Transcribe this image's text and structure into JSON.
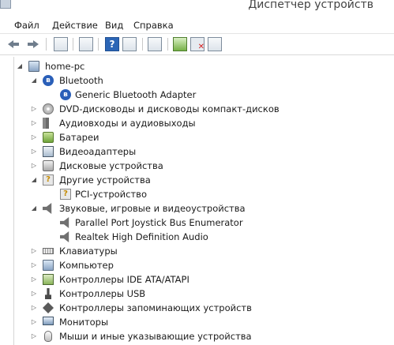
{
  "window": {
    "title": "Диспетчер устройств"
  },
  "menubar": {
    "items": [
      "Файл",
      "Действие",
      "Вид",
      "Справка"
    ]
  },
  "toolbar": {
    "help_glyph": "?"
  },
  "tree": {
    "root": "home-pc",
    "bluetooth": "Bluetooth",
    "bluetooth_adapter": "Generic Bluetooth Adapter",
    "dvd": "DVD-дисководы и дисководы компакт-дисков",
    "audio_io": "Аудиовходы и аудиовыходы",
    "batteries": "Батареи",
    "video": "Видеоадаптеры",
    "disk": "Дисковые устройства",
    "other": "Другие устройства",
    "pci": "PCI-устройство",
    "sound": "Звуковые, игровые и видеоустройства",
    "joystick": "Parallel Port Joystick Bus Enumerator",
    "realtek": "Realtek High Definition Audio",
    "keyboards": "Клавиатуры",
    "computer": "Компьютер",
    "ide": "Контроллеры IDE ATA/ATAPI",
    "usb": "Контроллеры USB",
    "storage": "Контроллеры запоминающих устройств",
    "monitors": "Мониторы",
    "mice": "Мыши и иные указывающие устройства",
    "expanded_glyph": "◢",
    "collapsed_glyph": "▷",
    "unknown_glyph": "?",
    "bt_glyph": "ʙ"
  }
}
